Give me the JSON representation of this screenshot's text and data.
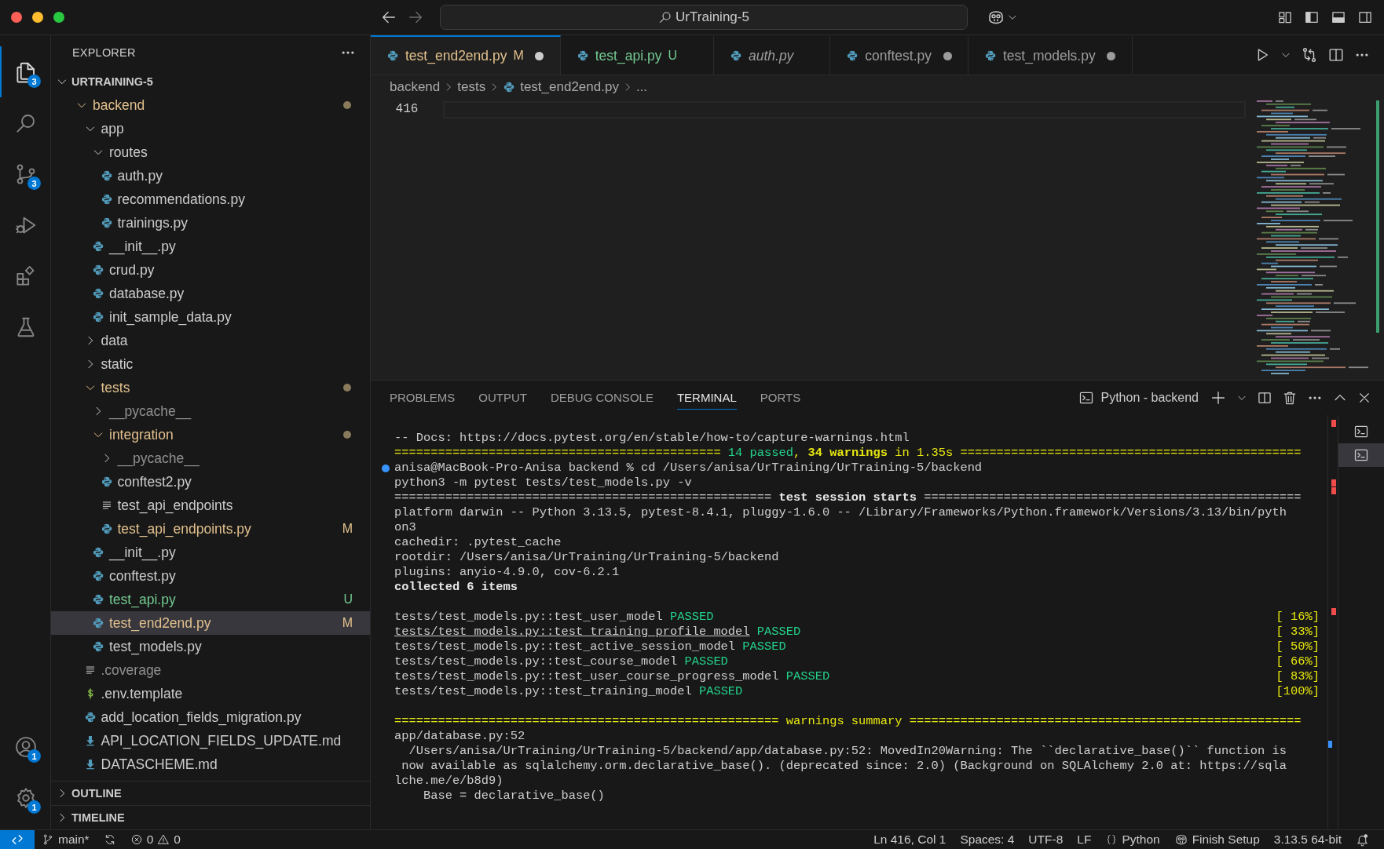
{
  "window": {
    "title": "UrTraining-5"
  },
  "activity_bar": {
    "items": [
      {
        "kind": "explorer",
        "selected": true,
        "badge": "3"
      },
      {
        "kind": "search",
        "selected": false
      },
      {
        "kind": "source-control",
        "selected": false,
        "badge": "3"
      },
      {
        "kind": "run-debug",
        "selected": false
      },
      {
        "kind": "extensions",
        "selected": false
      },
      {
        "kind": "testing",
        "selected": false
      }
    ],
    "bottom": [
      {
        "kind": "account",
        "badge": "1"
      },
      {
        "kind": "settings",
        "badge": "1"
      }
    ]
  },
  "sidebar": {
    "title": "EXPLORER",
    "root": {
      "name": "URTRAINING-5",
      "expanded": true
    },
    "tree": [
      {
        "name": "backend",
        "kind": "folder",
        "expanded": true,
        "modified": true,
        "untracked": false,
        "ignored": false,
        "dot": true,
        "selected": false,
        "children": [
          {
            "name": "app",
            "kind": "folder",
            "expanded": true,
            "modified": false,
            "untracked": false,
            "ignored": false,
            "dot": false,
            "selected": false,
            "children": [
              {
                "name": "routes",
                "kind": "folder",
                "expanded": true,
                "modified": false,
                "untracked": false,
                "ignored": false,
                "dot": false,
                "selected": false,
                "children": [
                  {
                    "name": "auth.py",
                    "kind": "python",
                    "modified": false,
                    "untracked": false,
                    "ignored": false,
                    "selected": false
                  },
                  {
                    "name": "recommendations.py",
                    "kind": "python",
                    "modified": false,
                    "untracked": false,
                    "ignored": false,
                    "selected": false
                  },
                  {
                    "name": "trainings.py",
                    "kind": "python",
                    "modified": false,
                    "untracked": false,
                    "ignored": false,
                    "selected": false
                  }
                ]
              },
              {
                "name": "__init__.py",
                "kind": "python",
                "modified": false,
                "untracked": false,
                "ignored": false,
                "selected": false
              },
              {
                "name": "crud.py",
                "kind": "python",
                "modified": false,
                "untracked": false,
                "ignored": false,
                "selected": false
              },
              {
                "name": "database.py",
                "kind": "python",
                "modified": false,
                "untracked": false,
                "ignored": false,
                "selected": false
              },
              {
                "name": "init_sample_data.py",
                "kind": "python",
                "modified": false,
                "untracked": false,
                "ignored": false,
                "selected": false
              }
            ]
          },
          {
            "name": "data",
            "kind": "folder",
            "expanded": false,
            "modified": false,
            "untracked": false,
            "ignored": false,
            "dot": false,
            "selected": false
          },
          {
            "name": "static",
            "kind": "folder",
            "expanded": false,
            "modified": false,
            "untracked": false,
            "ignored": false,
            "dot": false,
            "selected": false
          },
          {
            "name": "tests",
            "kind": "folder",
            "expanded": true,
            "modified": true,
            "untracked": false,
            "ignored": false,
            "dot": true,
            "selected": false,
            "children": [
              {
                "name": "__pycache__",
                "kind": "folder",
                "expanded": false,
                "modified": false,
                "untracked": false,
                "ignored": true,
                "dot": false,
                "selected": false
              },
              {
                "name": "integration",
                "kind": "folder",
                "expanded": true,
                "modified": true,
                "untracked": false,
                "ignored": false,
                "dot": true,
                "selected": false,
                "children": [
                  {
                    "name": "__pycache__",
                    "kind": "folder",
                    "expanded": false,
                    "modified": false,
                    "untracked": false,
                    "ignored": true,
                    "dot": false,
                    "selected": false
                  },
                  {
                    "name": "conftest2.py",
                    "kind": "python",
                    "modified": false,
                    "untracked": false,
                    "ignored": false,
                    "selected": false
                  },
                  {
                    "name": "test_api_endpoints",
                    "kind": "text",
                    "modified": false,
                    "untracked": false,
                    "ignored": false,
                    "selected": false
                  },
                  {
                    "name": "test_api_endpoints.py",
                    "kind": "python",
                    "modified": true,
                    "untracked": false,
                    "ignored": false,
                    "badge": "M",
                    "selected": false
                  }
                ]
              },
              {
                "name": "__init__.py",
                "kind": "python",
                "modified": false,
                "untracked": false,
                "ignored": false,
                "selected": false
              },
              {
                "name": "conftest.py",
                "kind": "python",
                "modified": false,
                "untracked": false,
                "ignored": false,
                "selected": false
              },
              {
                "name": "test_api.py",
                "kind": "python",
                "modified": false,
                "untracked": true,
                "ignored": false,
                "badge": "U",
                "selected": false
              },
              {
                "name": "test_end2end.py",
                "kind": "python",
                "modified": true,
                "untracked": false,
                "ignored": false,
                "badge": "M",
                "selected": true
              },
              {
                "name": "test_models.py",
                "kind": "python",
                "modified": false,
                "untracked": false,
                "ignored": false,
                "selected": false
              }
            ]
          },
          {
            "name": ".coverage",
            "kind": "text",
            "modified": false,
            "untracked": false,
            "ignored": true,
            "selected": false
          },
          {
            "name": ".env.template",
            "kind": "env",
            "modified": false,
            "untracked": false,
            "ignored": false,
            "selected": false
          },
          {
            "name": "add_location_fields_migration.py",
            "kind": "python",
            "modified": false,
            "untracked": false,
            "ignored": false,
            "selected": false
          },
          {
            "name": "API_LOCATION_FIELDS_UPDATE.md",
            "kind": "markdown",
            "modified": false,
            "untracked": false,
            "ignored": false,
            "selected": false
          },
          {
            "name": "DATASCHEME.md",
            "kind": "markdown",
            "modified": false,
            "untracked": false,
            "ignored": false,
            "selected": false
          }
        ]
      }
    ],
    "sections": [
      {
        "name": "OUTLINE",
        "expanded": false
      },
      {
        "name": "TIMELINE",
        "expanded": false
      }
    ]
  },
  "tabs": [
    {
      "label": "test_end2end.py",
      "selected": true,
      "modified": true,
      "untracked": false,
      "badge": "M",
      "dirty": true,
      "preview": false
    },
    {
      "label": "test_api.py",
      "selected": false,
      "modified": false,
      "untracked": true,
      "badge": "U",
      "dirty": false,
      "preview": false
    },
    {
      "label": "auth.py",
      "selected": false,
      "modified": false,
      "untracked": false,
      "dirty": false,
      "preview": true
    },
    {
      "label": "conftest.py",
      "selected": false,
      "modified": false,
      "untracked": false,
      "dirty": true,
      "preview": false
    },
    {
      "label": "test_models.py",
      "selected": false,
      "modified": false,
      "untracked": false,
      "dirty": true,
      "preview": false
    }
  ],
  "breadcrumbs": [
    {
      "label": "backend",
      "kind": "folder"
    },
    {
      "label": "tests",
      "kind": "folder"
    },
    {
      "label": "test_end2end.py",
      "kind": "file"
    },
    {
      "label": "...",
      "kind": "more"
    }
  ],
  "editor": {
    "line_number": "416"
  },
  "panel": {
    "tabs": [
      {
        "label": "PROBLEMS",
        "selected": false
      },
      {
        "label": "OUTPUT",
        "selected": false
      },
      {
        "label": "DEBUG CONSOLE",
        "selected": false
      },
      {
        "label": "TERMINAL",
        "selected": true
      },
      {
        "label": "PORTS",
        "selected": false
      }
    ],
    "terminal_name": "Python - backend",
    "lines": [
      {
        "segments": [
          {
            "text": "-- Docs: https://docs.pytest.org/en/stable/how-to/capture-warnings.html",
            "kind": "plain"
          }
        ]
      },
      {
        "segments": [
          {
            "text": "============================================= ",
            "kind": "warning"
          },
          {
            "text": "14 passed",
            "kind": "passed"
          },
          {
            "text": ", ",
            "kind": "warning"
          },
          {
            "text": "34 warnings",
            "kind": "warning-bold"
          },
          {
            "text": " in 1.35s ===============================================",
            "kind": "warning"
          }
        ]
      },
      {
        "dot": true,
        "segments": [
          {
            "text": "anisa@MacBook-Pro-Anisa backend % cd /Users/anisa/UrTraining/UrTraining-5/backend",
            "kind": "plain"
          }
        ]
      },
      {
        "segments": [
          {
            "text": "python3 -m pytest tests/test_models.py -v",
            "kind": "plain"
          }
        ]
      },
      {
        "segments": [
          {
            "text": "==================================================== ",
            "kind": "plain"
          },
          {
            "text": "test session starts",
            "kind": "bold"
          },
          {
            "text": " ====================================================",
            "kind": "plain"
          }
        ]
      },
      {
        "segments": [
          {
            "text": "platform darwin -- Python 3.13.5, pytest-8.4.1, pluggy-1.6.0 -- /Library/Frameworks/Python.framework/Versions/3.13/bin/pyth",
            "kind": "plain"
          }
        ]
      },
      {
        "segments": [
          {
            "text": "on3",
            "kind": "plain"
          }
        ]
      },
      {
        "segments": [
          {
            "text": "cachedir: .pytest_cache",
            "kind": "plain"
          }
        ]
      },
      {
        "segments": [
          {
            "text": "rootdir: /Users/anisa/UrTraining/UrTraining-5/backend",
            "kind": "plain"
          }
        ]
      },
      {
        "segments": [
          {
            "text": "plugins: anyio-4.9.0, cov-6.2.1",
            "kind": "plain"
          }
        ]
      },
      {
        "segments": [
          {
            "text": "collected 6 items",
            "kind": "bold"
          }
        ]
      },
      {
        "kind": "blank"
      },
      {
        "segments": [
          {
            "text": "tests/test_models.py::test_user_model ",
            "kind": "plain"
          },
          {
            "text": "PASSED",
            "kind": "passed"
          }
        ],
        "right": "[ 16%]"
      },
      {
        "segments": [
          {
            "text": "tests/test_models.py::test_training_profile_model",
            "kind": "link"
          },
          {
            "text": " PASSED",
            "kind": "passed"
          }
        ],
        "right": "[ 33%]"
      },
      {
        "segments": [
          {
            "text": "tests/test_models.py::test_active_session_model ",
            "kind": "plain"
          },
          {
            "text": "PASSED",
            "kind": "passed"
          }
        ],
        "right": "[ 50%]"
      },
      {
        "segments": [
          {
            "text": "tests/test_models.py::test_course_model ",
            "kind": "plain"
          },
          {
            "text": "PASSED",
            "kind": "passed"
          }
        ],
        "right": "[ 66%]"
      },
      {
        "segments": [
          {
            "text": "tests/test_models.py::test_user_course_progress_model ",
            "kind": "plain"
          },
          {
            "text": "PASSED",
            "kind": "passed"
          }
        ],
        "right": "[ 83%]"
      },
      {
        "segments": [
          {
            "text": "tests/test_models.py::test_training_model ",
            "kind": "plain"
          },
          {
            "text": "PASSED",
            "kind": "passed"
          }
        ],
        "right": "[100%]"
      },
      {
        "kind": "blank"
      },
      {
        "segments": [
          {
            "text": "===================================================== warnings summary ======================================================",
            "kind": "warning"
          }
        ]
      },
      {
        "segments": [
          {
            "text": "app/database.py:52",
            "kind": "plain"
          }
        ]
      },
      {
        "segments": [
          {
            "text": "  /Users/anisa/UrTraining/UrTraining-5/backend/app/database.py:52: MovedIn20Warning: The ``declarative_base()`` function is",
            "kind": "plain"
          }
        ]
      },
      {
        "segments": [
          {
            "text": " now available as sqlalchemy.orm.declarative_base(). (deprecated since: 2.0) (Background on SQLAlchemy 2.0 at: https://sqla",
            "kind": "plain"
          }
        ]
      },
      {
        "segments": [
          {
            "text": "lche.me/e/b8d9)",
            "kind": "plain"
          }
        ]
      },
      {
        "segments": [
          {
            "text": "    Base = declarative_base()",
            "kind": "plain"
          }
        ]
      }
    ],
    "terminals": [
      {
        "selected": false
      },
      {
        "selected": true
      }
    ]
  },
  "status_bar": {
    "branch": "main*",
    "errors": "0",
    "warnings": "0",
    "items": [
      "Ln 416, Col 1",
      "Spaces: 4",
      "UTF-8",
      "LF"
    ],
    "language": "Python",
    "copilot": "Finish Setup",
    "interpreter": "3.13.5 64-bit"
  }
}
